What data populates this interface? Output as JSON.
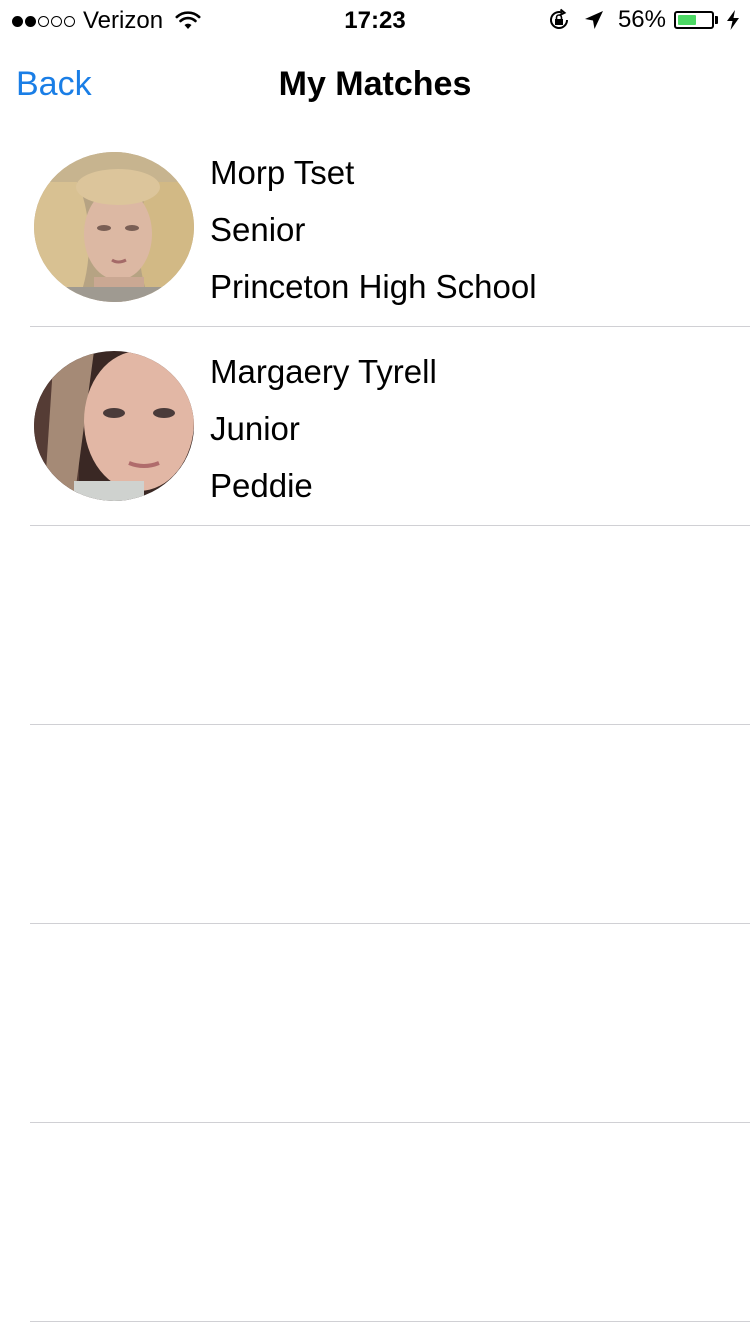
{
  "status_bar": {
    "carrier": "Verizon",
    "signal_bars_filled": 2,
    "signal_bars_total": 5,
    "time": "17:23",
    "battery_percent": "56%",
    "battery_level": 0.56,
    "battery_color": "#4cd964",
    "icons": [
      "wifi-icon",
      "rotation-lock-icon",
      "location-arrow-icon",
      "battery-icon",
      "charging-bolt-icon"
    ]
  },
  "nav": {
    "back_label": "Back",
    "title": "My Matches",
    "accent_color": "#1a7ee6"
  },
  "matches": [
    {
      "name": "Morp Tset",
      "grade": "Senior",
      "school": "Princeton High School"
    },
    {
      "name": "Margaery Tyrell",
      "grade": "Junior",
      "school": "Peddie"
    }
  ],
  "empty_rows": 4
}
